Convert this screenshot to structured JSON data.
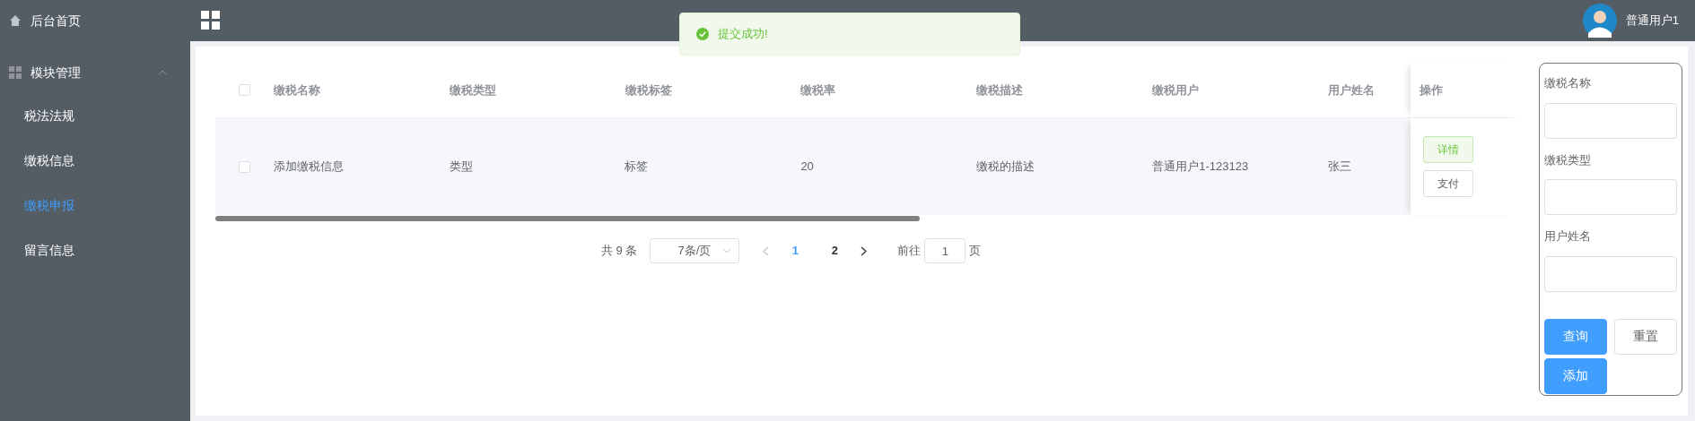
{
  "sidebar": {
    "items": [
      {
        "label": "后台首页",
        "selected": false
      },
      {
        "label": "模块管理",
        "selected": false,
        "expanded": true,
        "children": [
          {
            "label": "税法法规",
            "selected": false
          },
          {
            "label": "缴税信息",
            "selected": false
          },
          {
            "label": "缴税申报",
            "selected": true
          },
          {
            "label": "留言信息",
            "selected": false
          }
        ]
      }
    ]
  },
  "header": {
    "user": "普通用户1"
  },
  "toast": {
    "message": "提交成功!"
  },
  "table": {
    "select_all_checked": false,
    "columns": [
      "缴税名称",
      "缴税类型",
      "缴税标签",
      "缴税率",
      "缴税描述",
      "缴税用户",
      "用户姓名",
      "操作"
    ],
    "rows": [
      {
        "checked": false,
        "cells": [
          "添加缴税信息",
          "类型",
          "标签",
          "20",
          "缴税的描述",
          "普通用户1-123123",
          "张三"
        ],
        "actions": [
          {
            "label": "详情",
            "kind": "success"
          },
          {
            "label": "支付",
            "kind": "plain"
          }
        ]
      }
    ]
  },
  "pagination": {
    "total": "共 9 条",
    "page_size": "7条/页",
    "pages": [
      {
        "label": "1",
        "selected": true
      },
      {
        "label": "2",
        "selected": false
      }
    ],
    "goto_label": "前往",
    "goto_value": "1",
    "goto_suffix": "页"
  },
  "search_panel": {
    "fields": [
      {
        "label": "缴税名称"
      },
      {
        "label": "缴税类型"
      },
      {
        "label": "用户姓名"
      }
    ],
    "buttons": [
      {
        "label": "查询",
        "kind": "primary"
      },
      {
        "label": "重置",
        "kind": "plain"
      },
      {
        "label": "添加",
        "kind": "primary"
      }
    ]
  }
}
